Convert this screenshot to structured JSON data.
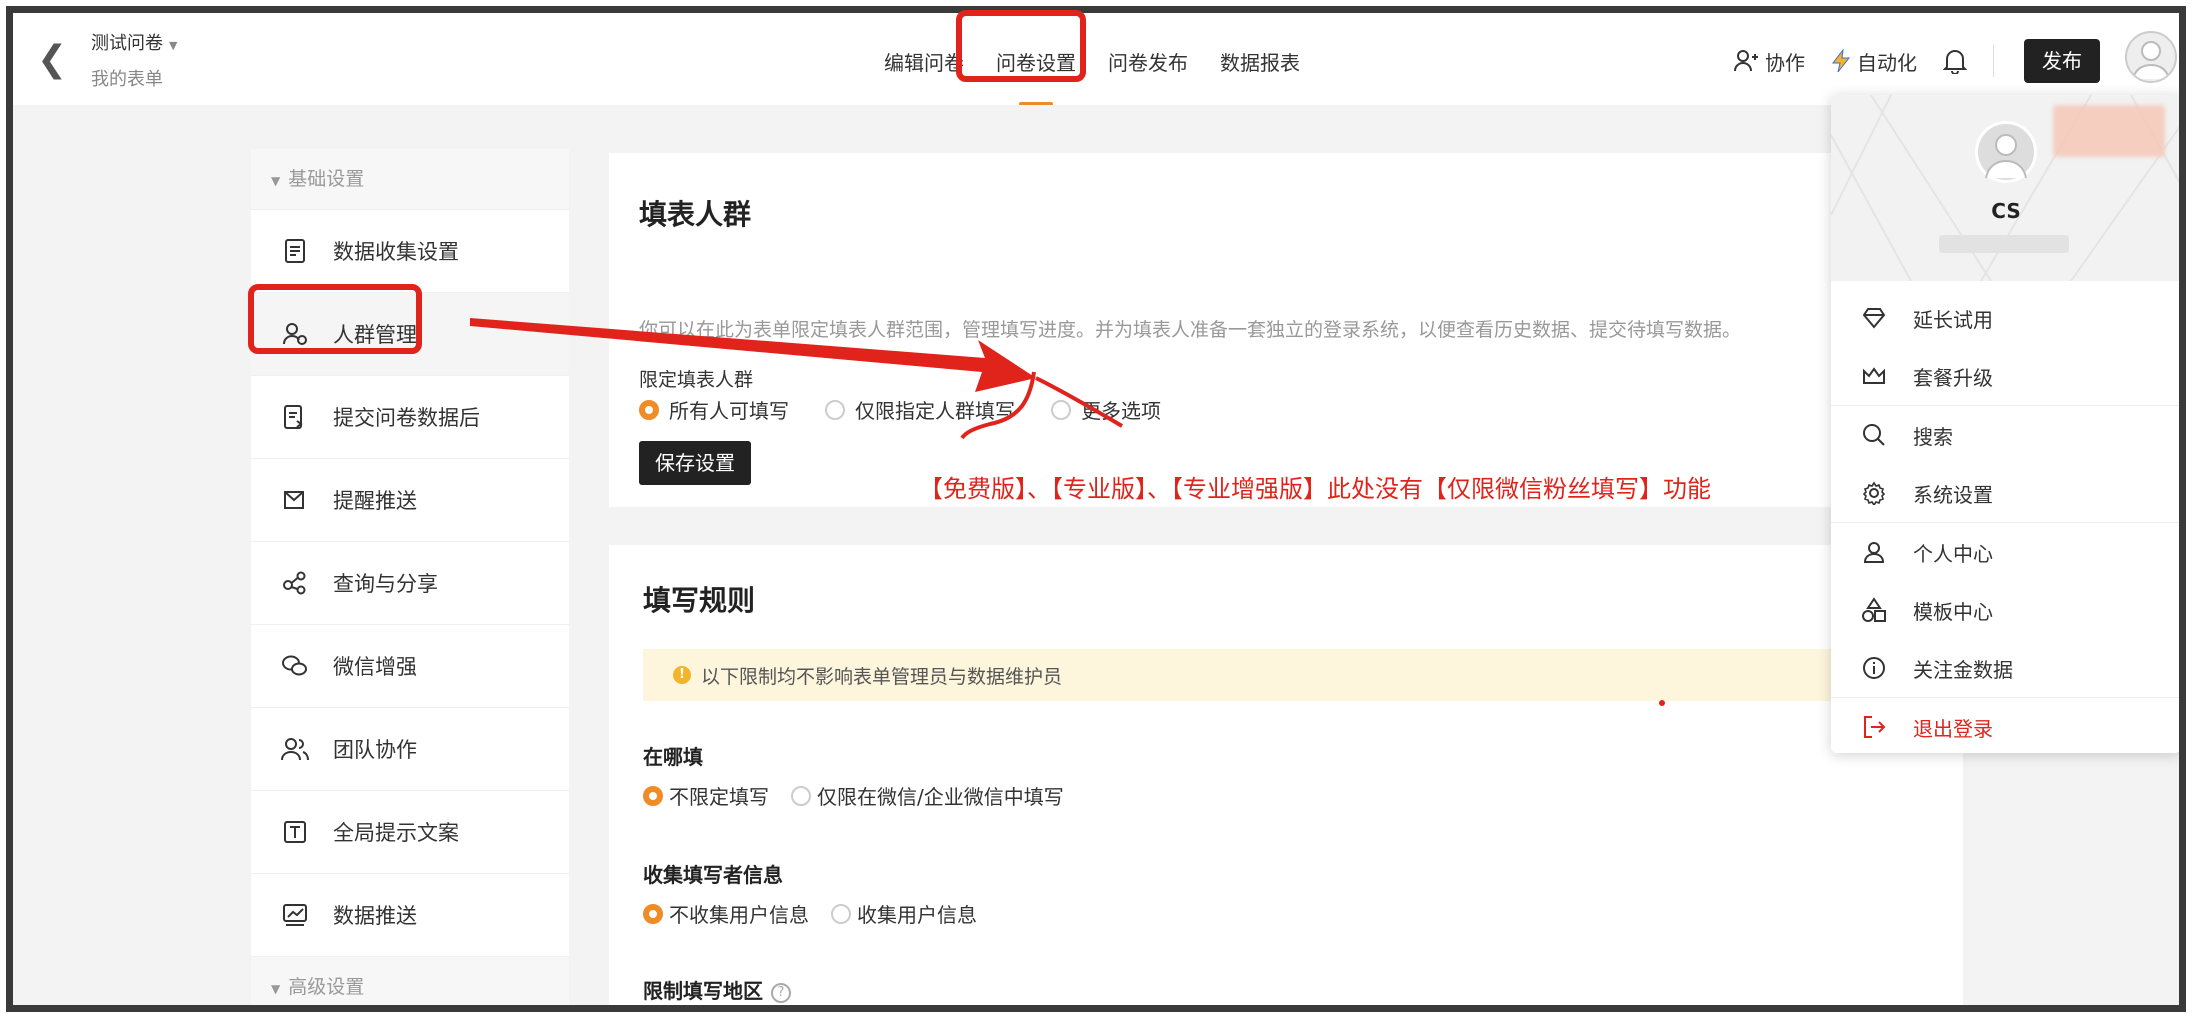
{
  "header": {
    "back_icon": "chevron-left-icon",
    "title": "测试问卷",
    "subtitle": "我的表单",
    "tabs": [
      {
        "label": "编辑问卷"
      },
      {
        "label": "问卷设置"
      },
      {
        "label": "问卷发布"
      },
      {
        "label": "数据报表"
      }
    ],
    "collab_label": "协作",
    "automation_label": "自动化",
    "publish_label": "发布"
  },
  "sidebar": {
    "group_basic": "基础设置",
    "group_advanced": "高级设置",
    "items": [
      {
        "label": "数据收集设置",
        "icon": "document-icon"
      },
      {
        "label": "人群管理",
        "icon": "people-icon"
      },
      {
        "label": "提交问卷数据后",
        "icon": "document-arrow-icon"
      },
      {
        "label": "提醒推送",
        "icon": "send-icon"
      },
      {
        "label": "查询与分享",
        "icon": "share-icon"
      },
      {
        "label": "微信增强",
        "icon": "wechat-icon"
      },
      {
        "label": "团队协作",
        "icon": "team-icon"
      },
      {
        "label": "全局提示文案",
        "icon": "text-box-icon"
      },
      {
        "label": "数据推送",
        "icon": "chart-box-icon"
      }
    ]
  },
  "card1": {
    "title": "填表人群",
    "description": "你可以在此为表单限定填表人群范围，管理填写进度。并为填表人准备一套独立的登录系统，以便查看历史数据、提交待填写数据。",
    "limit_label": "限定填表人群",
    "options": [
      "所有人可填写",
      "仅限指定人群填写",
      "更多选项"
    ],
    "save_label": "保存设置",
    "note": "【免费版】、【专业版】、【专业增强版】此处没有【仅限微信粉丝填写】功能"
  },
  "card2": {
    "title": "填写规则",
    "tip": "以下限制均不影响表单管理员与数据维护员",
    "where_label": "在哪填",
    "where_options": [
      "不限定填写",
      "仅限在微信/企业微信中填写"
    ],
    "collect_label": "收集填写者信息",
    "collect_options": [
      "不收集用户信息",
      "收集用户信息"
    ],
    "region_label": "限制填写地区"
  },
  "dropdown": {
    "name": "CS",
    "items": [
      {
        "label": "延长试用",
        "icon": "diamond-icon"
      },
      {
        "label": "套餐升级",
        "icon": "crown-icon"
      },
      {
        "label": "搜索",
        "icon": "search-icon"
      },
      {
        "label": "系统设置",
        "icon": "gear-icon"
      },
      {
        "label": "个人中心",
        "icon": "user-icon"
      },
      {
        "label": "模板中心",
        "icon": "shapes-icon"
      },
      {
        "label": "关注金数据",
        "icon": "info-icon"
      },
      {
        "label": "退出登录",
        "icon": "logout-icon"
      }
    ]
  },
  "colors": {
    "accent": "#f08c28",
    "annotation_red": "#e0241c",
    "dark_button": "#222222"
  }
}
